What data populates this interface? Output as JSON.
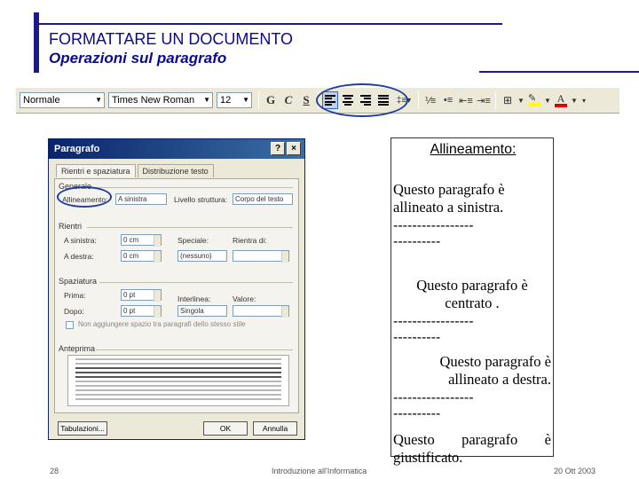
{
  "slide": {
    "title": "FORMATTARE UN DOCUMENTO",
    "subtitle": "Operazioni sul paragrafo",
    "footer_page": "28",
    "footer_center": "Introduzione all'Informatica",
    "footer_date": "20 Ott 2003"
  },
  "toolbar": {
    "style_value": "Normale",
    "font_value": "Times New Roman",
    "size_value": "12",
    "btn_g": "G",
    "btn_c": "C",
    "btn_s": "S"
  },
  "dialog": {
    "title": "Paragrafo",
    "help": "?",
    "close": "×",
    "tabs": [
      "Rientri e spaziatura",
      "Distribuzione testo"
    ],
    "group_general": "Generale",
    "label_alignment": "Allineamento:",
    "value_alignment": "A sinistra",
    "label_outline": "Livello struttura:",
    "value_outline": "Corpo del testo",
    "group_indent": "Rientri",
    "label_left": "A sinistra:",
    "value_left": "0 cm",
    "label_right": "A destra:",
    "value_right": "0 cm",
    "label_special": "Speciale:",
    "value_special": "(nessuno)",
    "label_by": "Rientra di:",
    "group_spacing": "Spaziatura",
    "label_before": "Prima:",
    "value_before": "0 pt",
    "label_after": "Dopo:",
    "value_after": "0 pt",
    "label_line": "Interlinea:",
    "value_line": "Singola",
    "label_at": "Valore:",
    "checkbox_label": "Non aggiungere spazio tra paragrafi dello stesso stile",
    "group_preview": "Anteprima",
    "btn_tabs": "Tabulazioni...",
    "btn_ok": "OK",
    "btn_cancel": "Annulla"
  },
  "textbox": {
    "heading": "Allineamento:",
    "para_left": "Questo paragrafo è allineato a sinistra.",
    "dash1": "-----------------",
    "dash2": "----------",
    "para_center": "Questo paragrafo è centrato .",
    "dash3": "-----------------",
    "dash4": "----------",
    "para_right": "Questo paragrafo è allineato a destra.",
    "dash5": "-----------------",
    "dash6": "----------",
    "para_justify": "Questo paragrafo è giustificato."
  }
}
